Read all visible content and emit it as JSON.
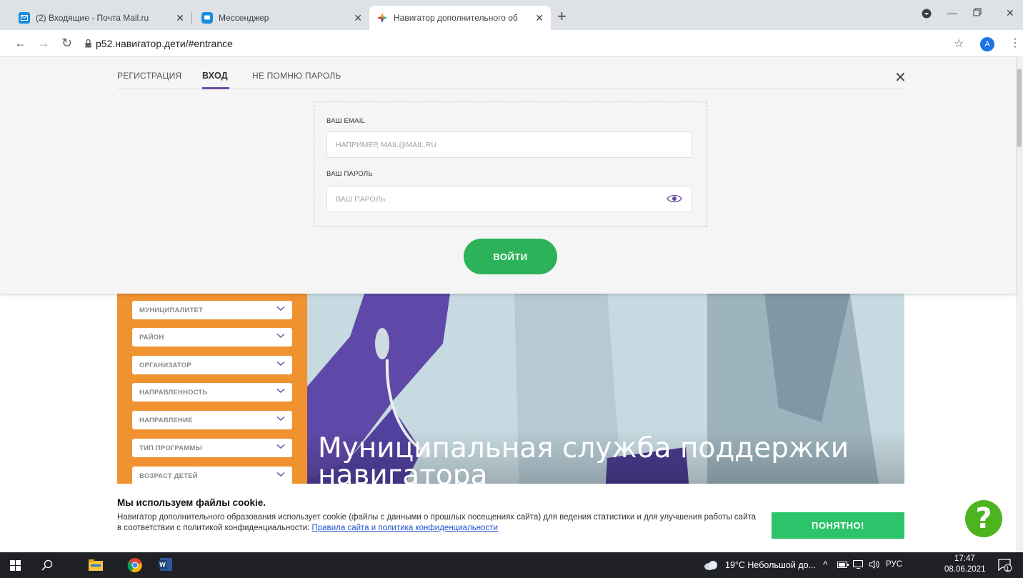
{
  "browser": {
    "tabs": [
      {
        "title": "(2) Входящие - Почта Mail.ru",
        "icon": "mail-icon"
      },
      {
        "title": "Мессенджер",
        "icon": "messenger-icon"
      },
      {
        "title": "Навигатор дополнительного об",
        "icon": "navigator-icon",
        "active": true
      }
    ],
    "url": "p52.навигатор.дети/#entrance",
    "profile_initial": "A"
  },
  "login": {
    "tabs": [
      "РЕГИСТРАЦИЯ",
      "ВХОД",
      "НЕ ПОМНЮ ПАРОЛЬ"
    ],
    "active_tab": "ВХОД",
    "email_label": "ВАШ EMAIL",
    "email_placeholder": "НАПРИМЕР, MAIL@MAIL.RU",
    "password_label": "ВАШ ПАРОЛЬ",
    "password_placeholder": "ВАШ ПАРОЛЬ",
    "submit_label": "ВОЙТИ"
  },
  "filters": [
    "МУНИЦИПАЛИТЕТ",
    "РАЙОН",
    "ОРГАНИЗАТОР",
    "НАПРАВЛЕННОСТЬ",
    "НАПРАВЛЕНИЕ",
    "ТИП ПРОГРАММЫ",
    "ВОЗРАСТ ДЕТЕЙ"
  ],
  "banner": {
    "title_line1": "Муниципальная служба поддержки",
    "title_line2": "навигатора"
  },
  "cookie": {
    "title": "Мы используем файлы cookie.",
    "text": "Навигатор дополнительного образования использует cookie (файлы с данными о прошлых посещениях сайта) для ведения статистики и для улучшения работы сайта в соответствии с политикой конфиденциальности: ",
    "link": "Правила сайта и политика конфиденциальности",
    "button": "ПОНЯТНО!",
    "help": "?"
  },
  "taskbar": {
    "weather": "19°C  Небольшой до...",
    "lang": "РУС",
    "time": "17:47",
    "date": "08.06.2021",
    "notifications": "1"
  },
  "colors": {
    "accent_green": "#2cb35a",
    "filters_orange": "#f0922f",
    "active_underline": "#6a4c9c",
    "help_green": "#4db31f"
  }
}
